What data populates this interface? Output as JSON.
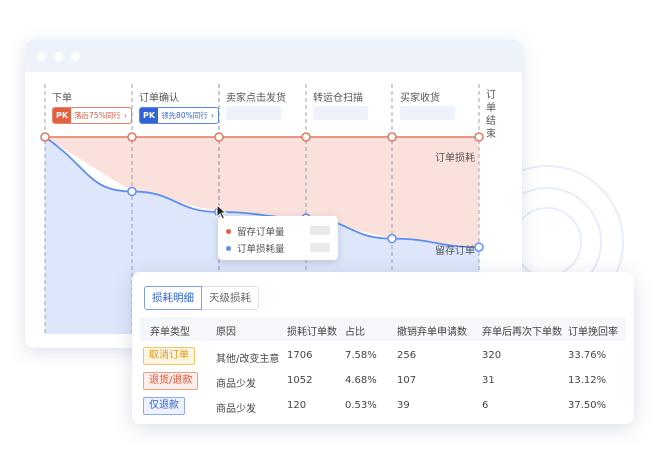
{
  "stages": [
    {
      "label": "下单",
      "pk": {
        "tag": "PK",
        "text": "落后75%同行",
        "color": "red"
      }
    },
    {
      "label": "订单确认",
      "pk": {
        "tag": "PK",
        "text": "领先80%同行",
        "color": "blue"
      }
    },
    {
      "label": "卖家点击发货"
    },
    {
      "label": "转运仓扫描"
    },
    {
      "label": "买家收货"
    },
    {
      "label": "订单结束"
    }
  ],
  "series": {
    "loss_label": "订单损耗",
    "retain_label": "留存订单"
  },
  "colors": {
    "loss_line": "#e2775e",
    "loss_fill": "#fbe1dc",
    "retain_line": "#5b8ff2",
    "retain_fill": "#dde6fb"
  },
  "retain_curve_fraction": [
    1.0,
    0.55,
    0.38,
    0.33,
    0.16,
    0.09
  ],
  "tooltip": {
    "row1": "留存订单量",
    "row2": "订单损耗量"
  },
  "panel": {
    "tabs": [
      "损耗明细",
      "天级损耗"
    ],
    "columns": [
      "弃单类型",
      "原因",
      "损耗订单数",
      "占比",
      "撤销弃单申请数",
      "弃单后再次下单数",
      "订单挽回率"
    ],
    "rows": [
      {
        "type": "取消订单",
        "type_style": "orange",
        "reason": "其他/改变主意",
        "loss": "1706",
        "ratio": "7.58%",
        "revoke": "256",
        "reorder": "320",
        "recover": "33.76%"
      },
      {
        "type": "退货/退款",
        "type_style": "red",
        "reason": "商品少发",
        "loss": "1052",
        "ratio": "4.68%",
        "revoke": "107",
        "reorder": "31",
        "recover": "13.12%"
      },
      {
        "type": "仅退款",
        "type_style": "blue",
        "reason": "商品少发",
        "loss": "120",
        "ratio": "0.53%",
        "revoke": "39",
        "reorder": "6",
        "recover": "37.50%"
      }
    ]
  }
}
